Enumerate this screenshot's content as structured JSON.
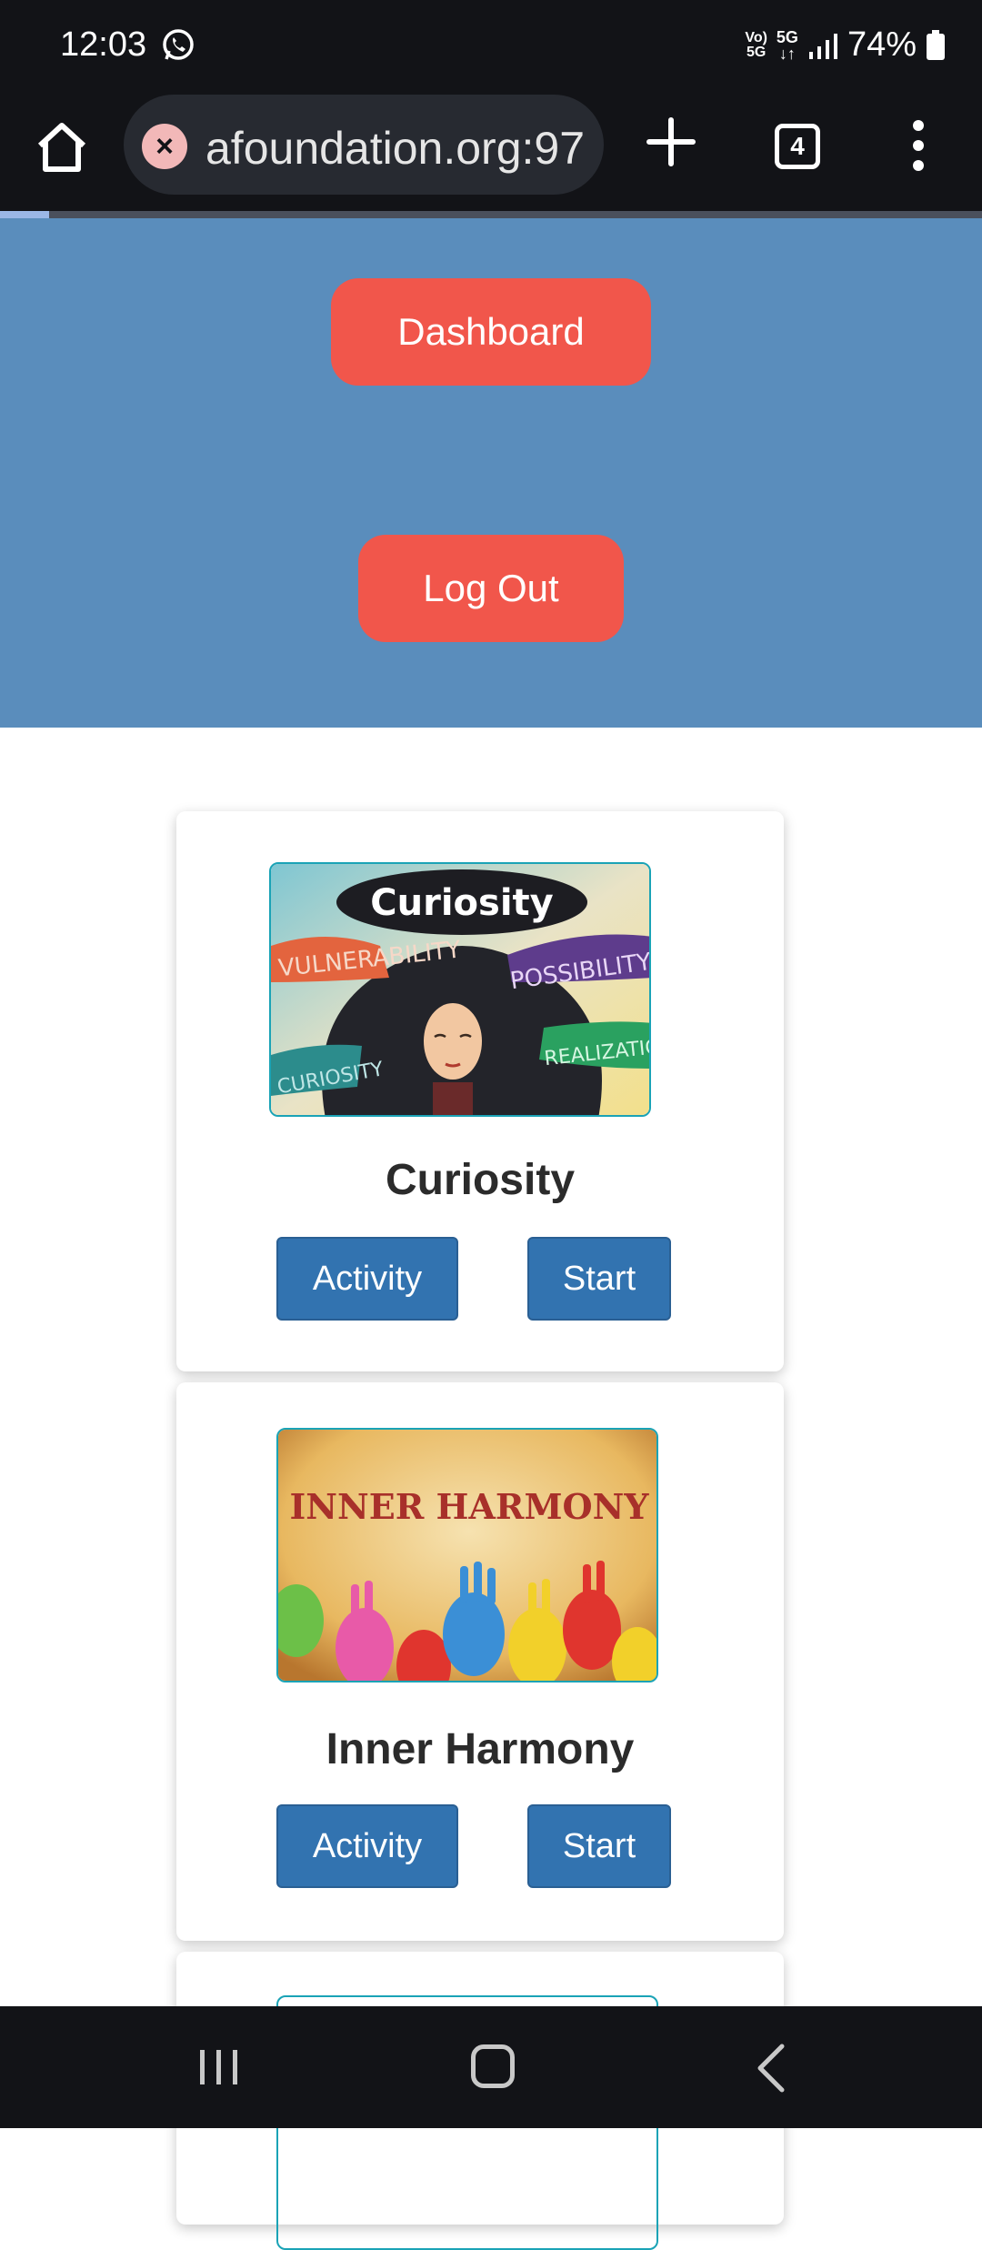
{
  "status_bar": {
    "time": "12:03",
    "volte": "Vo) 5G",
    "network": "5G",
    "battery": "74%"
  },
  "browser": {
    "url": "afoundation.org:97",
    "tab_count": "4",
    "load_progress": 0.05
  },
  "header": {
    "dashboard_label": "Dashboard",
    "logout_label": "Log Out"
  },
  "cards": [
    {
      "title": "Curiosity",
      "image_text": "Curiosity",
      "image_words": [
        "VULNERABILITY",
        "POSSIBILITY",
        "CURIOSITY",
        "REALIZATION"
      ],
      "activity_label": "Activity",
      "start_label": "Start"
    },
    {
      "title": "Inner Harmony",
      "image_text": "INNER HARMONY",
      "activity_label": "Activity",
      "start_label": "Start"
    }
  ],
  "colors": {
    "header_bg": "#5a8dbc",
    "red_button": "#f1564b",
    "blue_button": "#3273b0",
    "system_bar": "#121317"
  }
}
